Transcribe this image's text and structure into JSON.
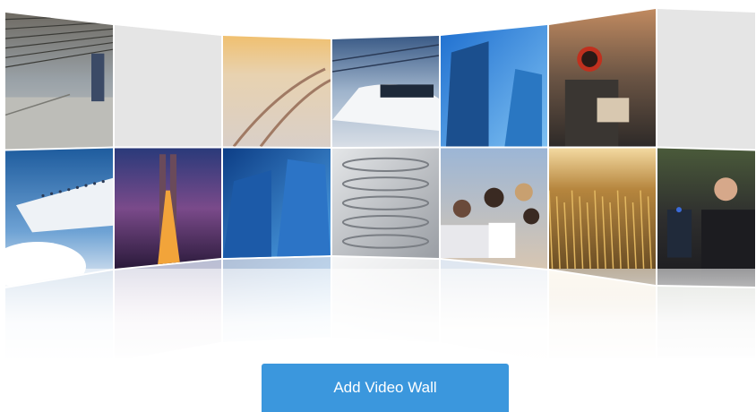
{
  "add_button": {
    "label": "Add Video Wall"
  },
  "colors": {
    "accent": "#3b97dd",
    "empty_tile": "#e5e5e5",
    "background": "#ffffff"
  },
  "tiles": [
    {
      "row": 0,
      "col": 0,
      "name": "airport-terminal-tile",
      "scene": "airport"
    },
    {
      "row": 0,
      "col": 1,
      "name": "empty-tile",
      "scene": "empty"
    },
    {
      "row": 0,
      "col": 2,
      "name": "snowy-road-tile",
      "scene": "snowroad"
    },
    {
      "row": 0,
      "col": 3,
      "name": "bullet-train-tile",
      "scene": "train"
    },
    {
      "row": 0,
      "col": 4,
      "name": "glass-towers-tile",
      "scene": "towers"
    },
    {
      "row": 0,
      "col": 5,
      "name": "motorcyclist-tile",
      "scene": "rider"
    },
    {
      "row": 0,
      "col": 6,
      "name": "empty-tile",
      "scene": "empty"
    },
    {
      "row": 1,
      "col": 0,
      "name": "airplane-clouds-tile",
      "scene": "airplane"
    },
    {
      "row": 1,
      "col": 1,
      "name": "bridge-night-tile",
      "scene": "bridge"
    },
    {
      "row": 1,
      "col": 2,
      "name": "skyscrapers-tile",
      "scene": "skyscrapers"
    },
    {
      "row": 1,
      "col": 3,
      "name": "architecture-tile",
      "scene": "architecture"
    },
    {
      "row": 1,
      "col": 4,
      "name": "classroom-tile",
      "scene": "classroom"
    },
    {
      "row": 1,
      "col": 5,
      "name": "wheat-field-tile",
      "scene": "wheat"
    },
    {
      "row": 1,
      "col": 6,
      "name": "police-officer-tile",
      "scene": "police"
    }
  ]
}
